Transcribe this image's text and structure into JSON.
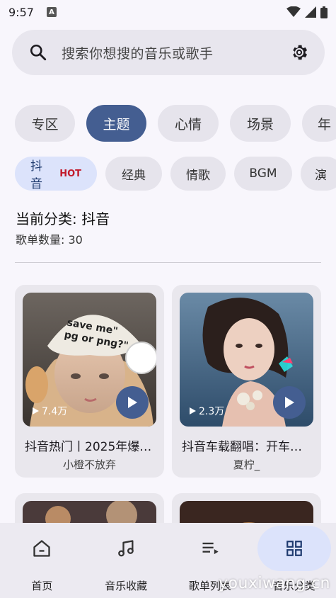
{
  "status": {
    "time": "9:57",
    "a_icon": "A"
  },
  "search": {
    "placeholder": "搜索你想搜的音乐或歌手"
  },
  "categories": [
    {
      "label": "专区",
      "active": false
    },
    {
      "label": "主题",
      "active": true
    },
    {
      "label": "心情",
      "active": false
    },
    {
      "label": "场景",
      "active": false
    },
    {
      "label": "年",
      "active": false
    }
  ],
  "tags": [
    {
      "label": "抖音",
      "badge": "HOT",
      "active": true
    },
    {
      "label": "经典",
      "active": false
    },
    {
      "label": "情歌",
      "active": false
    },
    {
      "label": "BGM",
      "active": false
    },
    {
      "label": "演",
      "active": false
    }
  ],
  "current": {
    "label": "当前分类: 抖音",
    "count": "歌单数量: 30"
  },
  "cards": [
    {
      "plays": "7.4万",
      "title": "抖音热门丨2025年爆…",
      "author": "小橙不放弃",
      "img_text": "I save me\" png or png?\""
    },
    {
      "plays": "2.3万",
      "title": "抖音车载翻唱：开车…",
      "author": "夏柠_"
    },
    {
      "plays": "",
      "title": "",
      "author": ""
    },
    {
      "plays": "",
      "title": "",
      "author": ""
    }
  ],
  "nav": [
    {
      "label": "首页",
      "icon": "home-icon",
      "active": false
    },
    {
      "label": "音乐收藏",
      "icon": "music-note-icon",
      "active": false
    },
    {
      "label": "歌单列表",
      "icon": "playlist-icon",
      "active": false
    },
    {
      "label": "音乐分类",
      "icon": "grid-icon",
      "active": true
    }
  ],
  "watermark": "youxiwang.cn",
  "colors": {
    "accent": "#445e91",
    "chip_active_light": "#dce3fb",
    "hot": "#c21a2b"
  }
}
